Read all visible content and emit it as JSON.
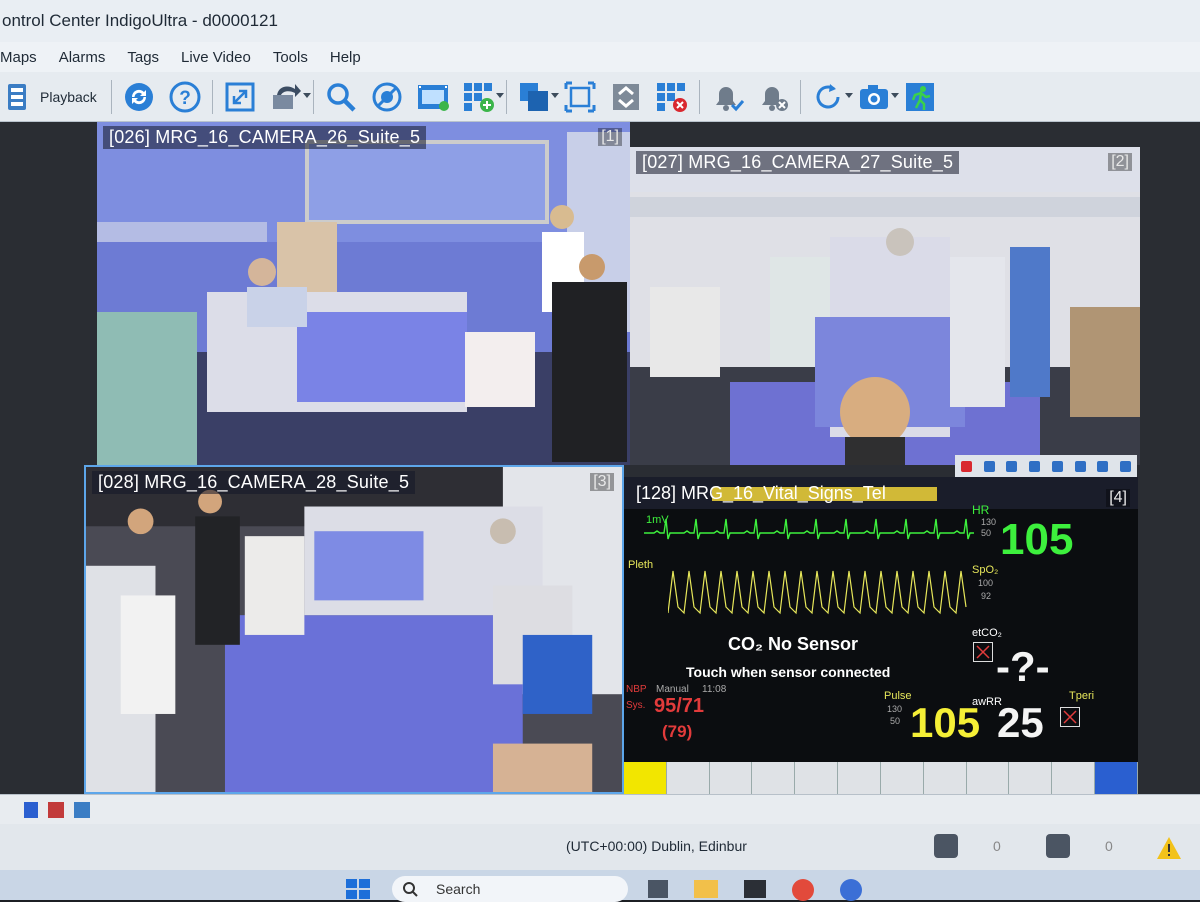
{
  "window": {
    "title": "ontrol Center IndigoUltra - d0000121"
  },
  "menu": {
    "items": [
      "Maps",
      "Alarms",
      "Tags",
      "Live Video",
      "Tools",
      "Help"
    ]
  },
  "toolbar": {
    "playback_label": "Playback",
    "icons": [
      "refresh-icon",
      "help-icon",
      "fullscreen-icon",
      "export-icon",
      "search-icon",
      "no-filter-icon",
      "film-icon",
      "add-layout-icon",
      "layout-icon",
      "fit-icon",
      "swap-icon",
      "remove-layout-icon",
      "alarm-ack-icon",
      "alarm-clear-icon",
      "rotate-icon",
      "snapshot-icon",
      "run-icon"
    ]
  },
  "tiles": [
    {
      "label": "[026] MRG_16_CAMERA_26_Suite_5",
      "index": "[1]"
    },
    {
      "label": "[027] MRG_16_CAMERA_27_Suite_5",
      "index": "[2]"
    },
    {
      "label": "[028] MRG_16_CAMERA_28_Suite_5",
      "index": "[3]"
    },
    {
      "label": "[128] MRG_16_Vital_Signs_Tel",
      "index": "[4]"
    }
  ],
  "monitor": {
    "ecg_lead": "1mV",
    "hr_label": "HR",
    "hr_value": "105",
    "hr_limits": [
      "130",
      "50"
    ],
    "pleth_label": "Pleth",
    "spo2_label": "SpO₂",
    "spo2_limits": [
      "100",
      "92"
    ],
    "co2_msg": "CO₂ No Sensor",
    "co2_sub": "Touch when sensor connected",
    "etco2_label": "etCO₂",
    "etco2_value": "-?-",
    "awrr_label": "awRR",
    "awrr_value": "25",
    "nibp_label": "NBP",
    "nibp_mode": "Manual",
    "nibp_time": "11:08",
    "nibp_sys_label": "Sys.",
    "nibp_value": "95/71",
    "nibp_map": "(79)",
    "pulse_label": "Pulse",
    "pulse_limits": [
      "130",
      "50"
    ],
    "pulse_value": "105",
    "tperi_label": "Tperi"
  },
  "status": {
    "timezone": "(UTC+00:00) Dublin, Edinbur",
    "count1": "0",
    "count2": "0"
  },
  "taskbar": {
    "search_placeholder": "Search"
  }
}
